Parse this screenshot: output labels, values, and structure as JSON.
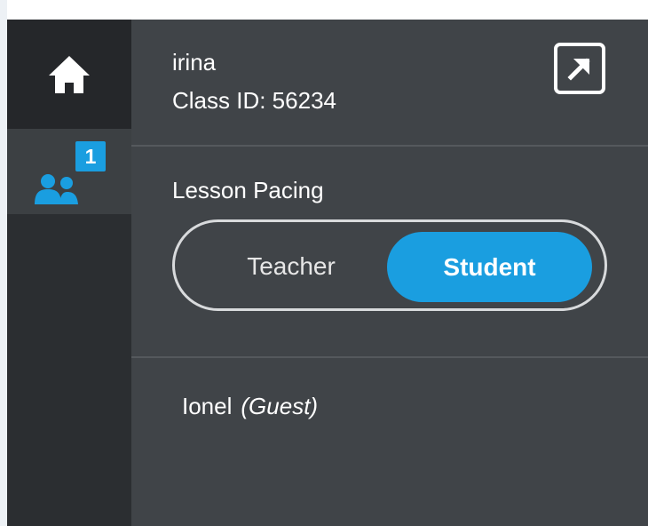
{
  "rail": {
    "home_icon": "home-icon",
    "participants_icon": "users-icon",
    "participants_badge": "1"
  },
  "class_info": {
    "user_name": "irina",
    "class_id": "Class ID: 56234",
    "popout_icon": "external-link-icon"
  },
  "pacing": {
    "label": "Lesson Pacing",
    "options": [
      "Teacher",
      "Student"
    ],
    "selected": "Student"
  },
  "participants": [
    {
      "name": "Ionel",
      "role": "(Guest)"
    }
  ],
  "colors": {
    "accent": "#1a9ee0",
    "rail": "#2b2e31",
    "panel": "#404448"
  }
}
